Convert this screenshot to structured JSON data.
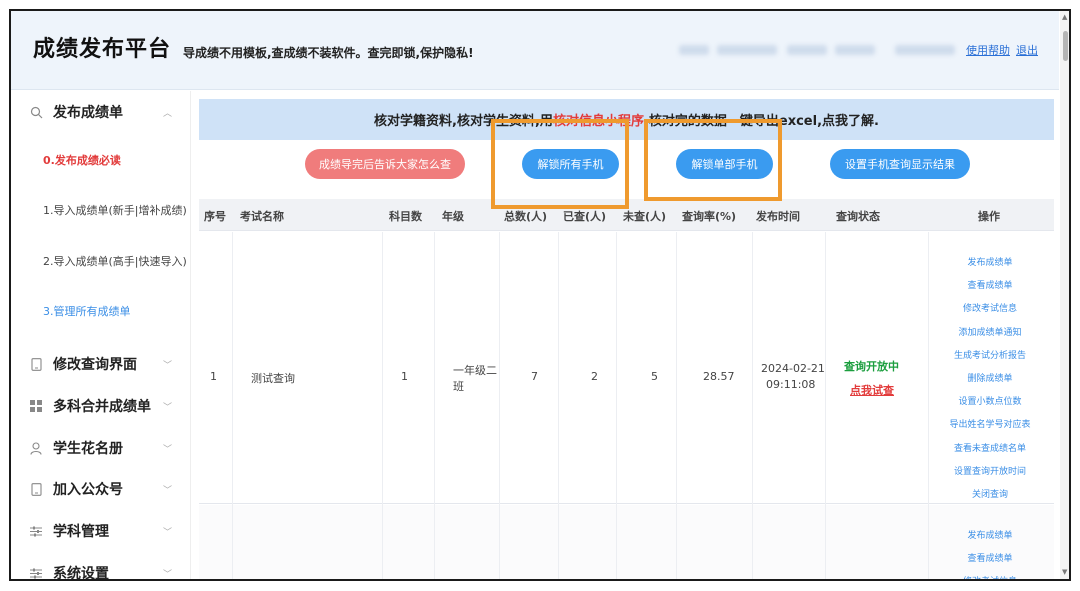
{
  "header": {
    "title": "成绩发布平台",
    "slogan": "导成绩不用模板,查成绩不装软件。查完即锁,保护隐私!",
    "help_link": "使用帮助",
    "logout_link": "退出"
  },
  "sidebar": {
    "sections": [
      {
        "icon": "search-icon",
        "label": "发布成绩单"
      },
      {
        "icon": "tablet-icon",
        "label": "修改查询界面"
      },
      {
        "icon": "grid-icon",
        "label": "多科合并成绩单"
      },
      {
        "icon": "user-icon",
        "label": "学生花名册"
      },
      {
        "icon": "tablet-icon",
        "label": "加入公众号"
      },
      {
        "icon": "sliders-icon",
        "label": "学科管理"
      },
      {
        "icon": "sliders-icon",
        "label": "系统设置"
      }
    ],
    "sub_items": [
      "0.发布成绩必读",
      "1.导入成绩单(新手|增补成绩)",
      "2.导入成绩单(高手|快速导入)",
      "3.管理所有成绩单"
    ]
  },
  "notice": {
    "prefix": "核对学籍资料,核对学生资料,用",
    "highlight": "核对信息小程序",
    "suffix": ",核对完的数据一键导出excel,点我了解."
  },
  "buttons": {
    "tell_everyone": "成绩导完后告诉大家怎么查",
    "unlock_all": "解锁所有手机",
    "unlock_partial": "解锁单部手机",
    "phone_result": "设置手机查询显示结果"
  },
  "table": {
    "headers": [
      "序号",
      "考试名称",
      "科目数",
      "年级",
      "总数(人)",
      "已查(人)",
      "未查(人)",
      "查询率(%)",
      "发布时间",
      "查询状态",
      "操作"
    ],
    "row": {
      "index": "1",
      "exam_name": "测试查询",
      "subjects": "1",
      "grade_line1": "一年级二",
      "grade_line2": "班",
      "total": "7",
      "checked": "2",
      "unchecked": "5",
      "rate": "28.57",
      "date": "2024-02-21",
      "time": "09:11:08",
      "status": "查询开放中",
      "try_link": "点我试查"
    },
    "operations": [
      "发布成绩单",
      "查看成绩单",
      "修改考试信息",
      "添加成绩单通知",
      "生成考试分析报告",
      "删除成绩单",
      "设置小数点位数",
      "导出姓名学号对应表",
      "查看未查成绩名单",
      "设置查询开放时间",
      "关闭查询"
    ],
    "operations_row2": [
      "发布成绩单",
      "查看成绩单",
      "修改考试信息"
    ]
  },
  "colors": {
    "accent_blue": "#3a9bf0",
    "accent_red": "#f07c7c",
    "highlight_box": "#ef9a2e",
    "status_green": "#1b9e3e"
  }
}
